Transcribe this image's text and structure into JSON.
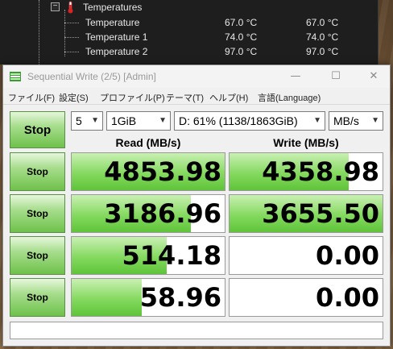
{
  "hwinfo": {
    "group_label": "Temperatures",
    "sensors": [
      {
        "name": "Temperature",
        "current": "67.0 °C",
        "min": "67.0 °C"
      },
      {
        "name": "Temperature 1",
        "current": "74.0 °C",
        "min": "74.0 °C"
      },
      {
        "name": "Temperature 2",
        "current": "97.0 °C",
        "min": "97.0 °C"
      }
    ]
  },
  "window": {
    "title": "Sequential Write (2/5) [Admin]",
    "minimize": "—",
    "maximize": "☐",
    "close": "✕"
  },
  "menu": [
    "ファイル(F)",
    "設定(S)",
    "プロファイル(P)",
    "テーマ(T)",
    "ヘルプ(H)",
    "言語(Language)"
  ],
  "controls": {
    "main_button": "Stop",
    "count": "5",
    "size": "1GiB",
    "drive": "D: 61% (1138/1863GiB)",
    "unit": "MB/s"
  },
  "columns": {
    "read": "Read (MB/s)",
    "write": "Write (MB/s)"
  },
  "tests": [
    {
      "button": "Stop",
      "read": "4853.98",
      "write": "4358.98",
      "read_fill": 1.0,
      "write_fill": 0.78
    },
    {
      "button": "Stop",
      "read": "3186.96",
      "write": "3655.50",
      "read_fill": 0.78,
      "write_fill": 1.0
    },
    {
      "button": "Stop",
      "read": "514.18",
      "write": "0.00",
      "read_fill": 0.62,
      "write_fill": 0
    },
    {
      "button": "Stop",
      "read": "58.96",
      "write": "0.00",
      "read_fill": 0.46,
      "write_fill": 0
    }
  ],
  "colors": {
    "accent_green": "#6fc14b",
    "title_text": "#9a9a9a"
  }
}
